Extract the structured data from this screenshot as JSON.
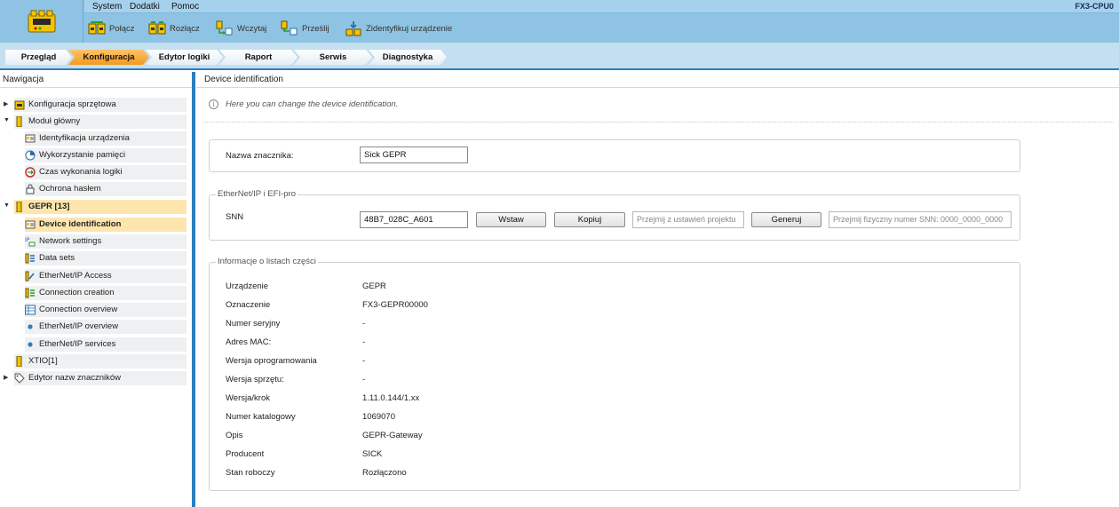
{
  "header": {
    "menu": [
      "System",
      "Dodatki",
      "Pomoc"
    ],
    "device_name": "FX3-CPU0",
    "toolbar": [
      {
        "label": "Połącz",
        "icon": "connect-icon"
      },
      {
        "label": "Rozłącz",
        "icon": "disconnect-icon"
      },
      {
        "label": "Wczytaj",
        "icon": "upload-icon"
      },
      {
        "label": "Prześlij",
        "icon": "download-icon"
      },
      {
        "label": "Zidentyfikuj urządzenie",
        "icon": "identify-device-icon"
      }
    ]
  },
  "tabs": [
    {
      "label": "Przegląd",
      "active": false
    },
    {
      "label": "Konfiguracja",
      "active": true
    },
    {
      "label": "Edytor logiki",
      "active": false
    },
    {
      "label": "Raport",
      "active": false
    },
    {
      "label": "Serwis",
      "active": false
    },
    {
      "label": "Diagnostyka",
      "active": false
    }
  ],
  "nav": {
    "title": "Nawigacja",
    "items": [
      {
        "label": "Konfiguracja sprzętowa",
        "icon": "hardware-config-icon"
      },
      {
        "label": "Moduł główny",
        "icon": "module-icon"
      },
      {
        "label": "Identyfikacja urządzenia",
        "icon": "device-id-icon"
      },
      {
        "label": "Wykorzystanie pamięci",
        "icon": "memory-usage-icon"
      },
      {
        "label": "Czas wykonania logiki",
        "icon": "execution-time-icon"
      },
      {
        "label": "Ochrona hasłem",
        "icon": "password-icon"
      },
      {
        "label": "GEPR [13]",
        "icon": "module-icon"
      },
      {
        "label": "Device identification",
        "icon": "device-id-icon"
      },
      {
        "label": "Network settings",
        "icon": "network-settings-icon"
      },
      {
        "label": "Data sets",
        "icon": "data-sets-icon"
      },
      {
        "label": "EtherNet/IP Access",
        "icon": "ethernet-access-icon"
      },
      {
        "label": "Connection creation",
        "icon": "connection-creation-icon"
      },
      {
        "label": "Connection overview",
        "icon": "connection-overview-icon"
      },
      {
        "label": "EtherNet/IP overview",
        "icon": "bullet-icon"
      },
      {
        "label": "EtherNet/IP services",
        "icon": "bullet-icon"
      },
      {
        "label": "XTIO[1]",
        "icon": "module-icon"
      },
      {
        "label": "Edytor nazw znaczników",
        "icon": "tag-editor-icon"
      }
    ]
  },
  "main": {
    "title": "Device identification",
    "info": "Here you can change the device identification.",
    "tag_name_label": "Nazwa znacznika:",
    "tag_name_value": "Sick GEPR",
    "ethernet_group": {
      "legend": "EtherNet/IP i EFI-pro",
      "snn_label": "SNN",
      "snn_value": "48B7_028C_A601",
      "paste_button": "Wstaw",
      "copy_button": "Kopiuj",
      "from_project_placeholder": "Przejmij z ustawień projektu",
      "generate_button": "Generuj",
      "physical_snn_placeholder": "Przejmij fizyczny numer SNN: 0000_0000_0000"
    },
    "parts_group": {
      "legend": "Informacje o listach części",
      "properties": [
        {
          "name": "Urządzenie",
          "value": "GEPR"
        },
        {
          "name": "Oznaczenie",
          "value": "FX3-GEPR00000"
        },
        {
          "name": "Numer seryjny",
          "value": "-"
        },
        {
          "name": "Adres MAC:",
          "value": "-"
        },
        {
          "name": "Wersja oprogramowania",
          "value": "-"
        },
        {
          "name": "Wersja sprzętu:",
          "value": "-"
        },
        {
          "name": "Wersja/krok",
          "value": "1.11.0.144/1.xx"
        },
        {
          "name": "Numer katalogowy",
          "value": "1069070"
        },
        {
          "name": "Opis",
          "value": "GEPR-Gateway"
        },
        {
          "name": "Producent",
          "value": "SICK"
        },
        {
          "name": "Stan roboczy",
          "value": "Rozłączono"
        }
      ]
    }
  }
}
